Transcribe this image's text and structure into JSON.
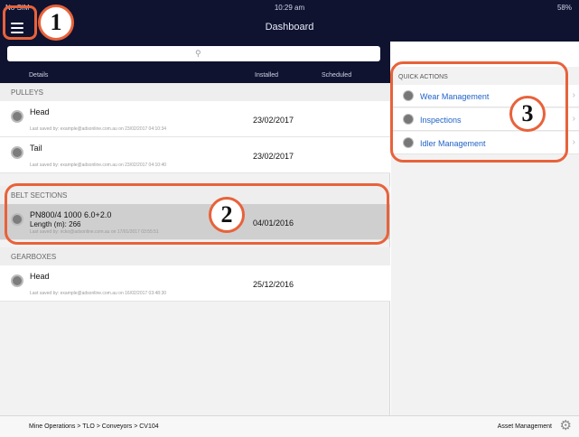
{
  "status_bar": {
    "carrier": "No SIM",
    "time": "10:29 am",
    "battery": "58%"
  },
  "nav": {
    "title": "Dashboard",
    "menu_icon": "hamburger-menu-icon"
  },
  "search": {
    "placeholder": "",
    "icon": "search-icon"
  },
  "columns": {
    "details": "Details",
    "installed": "Installed",
    "scheduled": "Scheduled"
  },
  "sections": [
    {
      "title": "PULLEYS",
      "items": [
        {
          "name": "Head",
          "sub": "",
          "saved": "Last saved by: example@adsonline.com.au on 23/02/2017 04:10:34",
          "installed": "23/02/2017",
          "selected": false
        },
        {
          "name": "Tail",
          "sub": "",
          "saved": "Last saved by: example@adsonline.com.au on 23/02/2017 04:10:40",
          "installed": "23/02/2017",
          "selected": false
        }
      ]
    },
    {
      "title": "BELT SECTIONS",
      "items": [
        {
          "name": "PN800/4 1000 6.0+2.0",
          "sub": "Length (m): 266",
          "saved": "Last saved by: ricko@adsonline.com.au on 17/01/2017 03:55:51",
          "installed": "04/01/2016",
          "selected": true
        }
      ]
    },
    {
      "title": "GEARBOXES",
      "items": [
        {
          "name": "Head",
          "sub": "",
          "saved": "Last saved by: example@adsonline.com.au on 16/02/2017 03:48:30",
          "installed": "25/12/2016",
          "selected": false
        }
      ]
    }
  ],
  "quick_actions": {
    "title": "QUICK ACTIONS",
    "items": [
      {
        "label": "Wear Management",
        "icon": "wear-icon"
      },
      {
        "label": "Inspections",
        "icon": "inspection-icon"
      },
      {
        "label": "Idler Management",
        "icon": "idler-icon"
      }
    ]
  },
  "footer": {
    "breadcrumb": "Mine Operations  >  TLO  >  Conveyors  >  CV104",
    "right_label": "Asset Management"
  },
  "callouts": [
    "1",
    "2",
    "3"
  ],
  "colors": {
    "nav": "#0f1330",
    "accent": "#e8623a",
    "link": "#1f62c8"
  }
}
